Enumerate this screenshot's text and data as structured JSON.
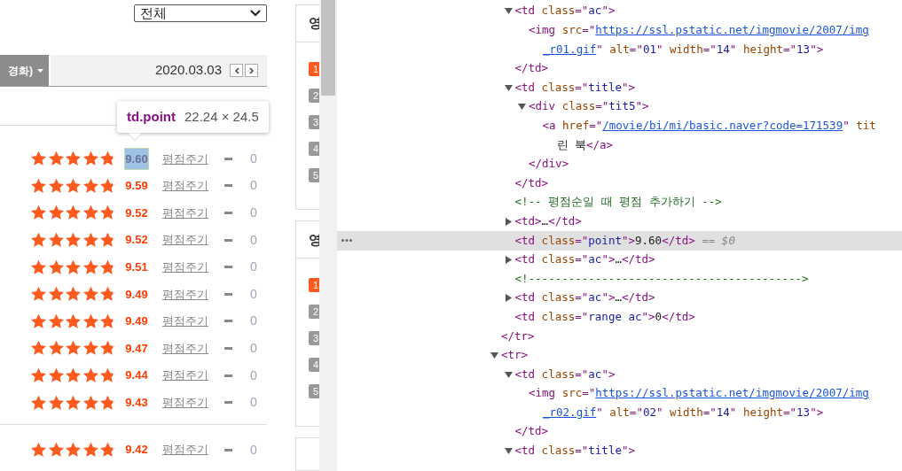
{
  "filter_select": {
    "value": "전체"
  },
  "category_tab": {
    "label": "경화)"
  },
  "date_bar": {
    "date": "2020.03.03"
  },
  "ranking_groups": [
    {
      "rows": [
        {
          "stars": 4.8,
          "rating": "9.60",
          "highlighted": true,
          "rate_link": "평점주기",
          "change": "0"
        },
        {
          "stars": 4.8,
          "rating": "9.59",
          "highlighted": false,
          "rate_link": "평점주기",
          "change": "0"
        },
        {
          "stars": 4.8,
          "rating": "9.52",
          "highlighted": false,
          "rate_link": "평점주기",
          "change": "0"
        },
        {
          "stars": 4.8,
          "rating": "9.52",
          "highlighted": false,
          "rate_link": "평점주기",
          "change": "0"
        },
        {
          "stars": 4.8,
          "rating": "9.51",
          "highlighted": false,
          "rate_link": "평점주기",
          "change": "0"
        },
        {
          "stars": 4.8,
          "rating": "9.49",
          "highlighted": false,
          "rate_link": "평점주기",
          "change": "0"
        },
        {
          "stars": 4.8,
          "rating": "9.49",
          "highlighted": false,
          "rate_link": "평점주기",
          "change": "0"
        },
        {
          "stars": 4.8,
          "rating": "9.47",
          "highlighted": false,
          "rate_link": "평점주기",
          "change": "0"
        },
        {
          "stars": 4.8,
          "rating": "9.44",
          "highlighted": false,
          "rate_link": "평점주기",
          "change": "0"
        },
        {
          "stars": 4.8,
          "rating": "9.43",
          "highlighted": false,
          "rate_link": "평점주기",
          "change": "0"
        }
      ]
    },
    {
      "rows": [
        {
          "stars": 4.8,
          "rating": "9.42",
          "highlighted": false,
          "rate_link": "평점주기",
          "change": "0"
        }
      ]
    }
  ],
  "inspect_tooltip": {
    "selector": "td.point",
    "size": "22.24 × 24.5"
  },
  "side_panels": [
    {
      "heading": "영",
      "ranks": [
        {
          "label": "1",
          "selected": true
        },
        {
          "label": "2",
          "selected": false
        },
        {
          "label": "3",
          "selected": false
        },
        {
          "label": "4",
          "selected": false
        },
        {
          "label": "5",
          "selected": false
        }
      ]
    },
    {
      "heading": "영",
      "ranks": [
        {
          "label": "1",
          "selected": true
        },
        {
          "label": "2",
          "selected": false
        },
        {
          "label": "3",
          "selected": false
        },
        {
          "label": "4",
          "selected": false
        },
        {
          "label": "5",
          "selected": false
        }
      ]
    }
  ],
  "dom_tree": [
    {
      "close": [
        {
          "kind": "tag",
          "text": "</tr>"
        }
      ],
      "children": [
        {
          "selected": false,
          "expanded": true,
          "lines": [
            [
              {
                "kind": "tag",
                "text": "<td "
              },
              {
                "kind": "attr",
                "text": "class"
              },
              {
                "kind": "tag",
                "text": "=\""
              },
              {
                "kind": "val",
                "text": "ac"
              },
              {
                "kind": "tag",
                "text": "\">"
              }
            ]
          ],
          "children": [
            {
              "selected": false,
              "lines": [
                [
                  {
                    "kind": "tag",
                    "text": "<img "
                  },
                  {
                    "kind": "attr",
                    "text": "src"
                  },
                  {
                    "kind": "tag",
                    "text": "=\""
                  },
                  {
                    "kind": "link",
                    "text": "https://ssl.pstatic.net/imgmovie/2007/img"
                  }
                ],
                [
                  {
                    "kind": "link",
                    "text": "_r01.gif"
                  },
                  {
                    "kind": "tag",
                    "text": "\" "
                  },
                  {
                    "kind": "attr",
                    "text": "alt"
                  },
                  {
                    "kind": "tag",
                    "text": "=\""
                  },
                  {
                    "kind": "val",
                    "text": "01"
                  },
                  {
                    "kind": "tag",
                    "text": "\" "
                  },
                  {
                    "kind": "attr",
                    "text": "width"
                  },
                  {
                    "kind": "tag",
                    "text": "=\""
                  },
                  {
                    "kind": "val",
                    "text": "14"
                  },
                  {
                    "kind": "tag",
                    "text": "\" "
                  },
                  {
                    "kind": "attr",
                    "text": "height"
                  },
                  {
                    "kind": "tag",
                    "text": "=\""
                  },
                  {
                    "kind": "val",
                    "text": "13"
                  },
                  {
                    "kind": "tag",
                    "text": "\">"
                  }
                ]
              ]
            }
          ],
          "close": [
            {
              "kind": "tag",
              "text": "</td>"
            }
          ]
        },
        {
          "selected": false,
          "expanded": true,
          "lines": [
            [
              {
                "kind": "tag",
                "text": "<td "
              },
              {
                "kind": "attr",
                "text": "class"
              },
              {
                "kind": "tag",
                "text": "=\""
              },
              {
                "kind": "val",
                "text": "title"
              },
              {
                "kind": "tag",
                "text": "\">"
              }
            ]
          ],
          "children": [
            {
              "selected": false,
              "expanded": true,
              "lines": [
                [
                  {
                    "kind": "tag",
                    "text": "<div "
                  },
                  {
                    "kind": "attr",
                    "text": "class"
                  },
                  {
                    "kind": "tag",
                    "text": "=\""
                  },
                  {
                    "kind": "val",
                    "text": "tit5"
                  },
                  {
                    "kind": "tag",
                    "text": "\">"
                  }
                ]
              ],
              "children": [
                {
                  "selected": false,
                  "lines": [
                    [
                      {
                        "kind": "tag",
                        "text": "<a "
                      },
                      {
                        "kind": "attr",
                        "text": "href"
                      },
                      {
                        "kind": "tag",
                        "text": "=\""
                      },
                      {
                        "kind": "link",
                        "text": "/movie/bi/mi/basic.naver?code=171539"
                      },
                      {
                        "kind": "tag",
                        "text": "\" "
                      },
                      {
                        "kind": "attr",
                        "text": "tit"
                      }
                    ],
                    [
                      {
                        "kind": "text",
                        "text": "린 북"
                      },
                      {
                        "kind": "tag",
                        "text": "</a>"
                      }
                    ]
                  ]
                }
              ],
              "close": [
                {
                  "kind": "tag",
                  "text": "</div>"
                }
              ]
            }
          ],
          "close": [
            {
              "kind": "tag",
              "text": "</td>"
            }
          ]
        },
        {
          "selected": false,
          "lines": [
            [
              {
                "kind": "comment",
                "text": "<!-- 평점순일 때 평점 추가하기  -->"
              }
            ]
          ]
        },
        {
          "selected": false,
          "expanded": false,
          "lines": [
            [
              {
                "kind": "tag",
                "text": "<td>"
              },
              {
                "kind": "text",
                "text": "…"
              },
              {
                "kind": "tag",
                "text": "</td>"
              }
            ]
          ]
        },
        {
          "selected": true,
          "lines": [
            [
              {
                "kind": "tag",
                "text": "<td "
              },
              {
                "kind": "attr",
                "text": "class"
              },
              {
                "kind": "tag",
                "text": "=\""
              },
              {
                "kind": "val",
                "text": "point"
              },
              {
                "kind": "tag",
                "text": "\">"
              },
              {
                "kind": "text",
                "text": "9.60"
              },
              {
                "kind": "tag",
                "text": "</td>"
              },
              {
                "kind": "hint",
                "text": " == $0"
              }
            ]
          ]
        },
        {
          "selected": false,
          "expanded": false,
          "lines": [
            [
              {
                "kind": "tag",
                "text": "<td "
              },
              {
                "kind": "attr",
                "text": "class"
              },
              {
                "kind": "tag",
                "text": "=\""
              },
              {
                "kind": "val",
                "text": "ac"
              },
              {
                "kind": "tag",
                "text": "\">"
              },
              {
                "kind": "text",
                "text": "…"
              },
              {
                "kind": "tag",
                "text": "</td>"
              }
            ]
          ]
        },
        {
          "selected": false,
          "lines": [
            [
              {
                "kind": "comment",
                "text": "<!----------------------------------------->"
              }
            ]
          ]
        },
        {
          "selected": false,
          "expanded": false,
          "lines": [
            [
              {
                "kind": "tag",
                "text": "<td "
              },
              {
                "kind": "attr",
                "text": "class"
              },
              {
                "kind": "tag",
                "text": "=\""
              },
              {
                "kind": "val",
                "text": "ac"
              },
              {
                "kind": "tag",
                "text": "\">"
              },
              {
                "kind": "text",
                "text": "…"
              },
              {
                "kind": "tag",
                "text": "</td>"
              }
            ]
          ]
        },
        {
          "selected": false,
          "lines": [
            [
              {
                "kind": "tag",
                "text": "<td "
              },
              {
                "kind": "attr",
                "text": "class"
              },
              {
                "kind": "tag",
                "text": "=\""
              },
              {
                "kind": "val",
                "text": "range ac"
              },
              {
                "kind": "tag",
                "text": "\">"
              },
              {
                "kind": "text",
                "text": "0"
              },
              {
                "kind": "tag",
                "text": "</td>"
              }
            ]
          ]
        }
      ]
    },
    {
      "selected": false,
      "expanded": true,
      "lines": [
        [
          {
            "kind": "tag",
            "text": "<tr>"
          }
        ]
      ],
      "children": [
        {
          "selected": false,
          "expanded": true,
          "lines": [
            [
              {
                "kind": "tag",
                "text": "<td "
              },
              {
                "kind": "attr",
                "text": "class"
              },
              {
                "kind": "tag",
                "text": "=\""
              },
              {
                "kind": "val",
                "text": "ac"
              },
              {
                "kind": "tag",
                "text": "\">"
              }
            ]
          ],
          "children": [
            {
              "selected": false,
              "lines": [
                [
                  {
                    "kind": "tag",
                    "text": "<img "
                  },
                  {
                    "kind": "attr",
                    "text": "src"
                  },
                  {
                    "kind": "tag",
                    "text": "=\""
                  },
                  {
                    "kind": "link",
                    "text": "https://ssl.pstatic.net/imgmovie/2007/img"
                  }
                ],
                [
                  {
                    "kind": "link",
                    "text": "_r02.gif"
                  },
                  {
                    "kind": "tag",
                    "text": "\" "
                  },
                  {
                    "kind": "attr",
                    "text": "alt"
                  },
                  {
                    "kind": "tag",
                    "text": "=\""
                  },
                  {
                    "kind": "val",
                    "text": "02"
                  },
                  {
                    "kind": "tag",
                    "text": "\" "
                  },
                  {
                    "kind": "attr",
                    "text": "width"
                  },
                  {
                    "kind": "tag",
                    "text": "=\""
                  },
                  {
                    "kind": "val",
                    "text": "14"
                  },
                  {
                    "kind": "tag",
                    "text": "\" "
                  },
                  {
                    "kind": "attr",
                    "text": "height"
                  },
                  {
                    "kind": "tag",
                    "text": "=\""
                  },
                  {
                    "kind": "val",
                    "text": "13"
                  },
                  {
                    "kind": "tag",
                    "text": "\">"
                  }
                ]
              ]
            }
          ],
          "close": [
            {
              "kind": "tag",
              "text": "</td>"
            }
          ]
        },
        {
          "selected": false,
          "expanded": true,
          "lines": [
            [
              {
                "kind": "tag",
                "text": "<td "
              },
              {
                "kind": "attr",
                "text": "class"
              },
              {
                "kind": "tag",
                "text": "=\""
              },
              {
                "kind": "val",
                "text": "title"
              },
              {
                "kind": "tag",
                "text": "\">"
              }
            ]
          ]
        }
      ]
    }
  ]
}
